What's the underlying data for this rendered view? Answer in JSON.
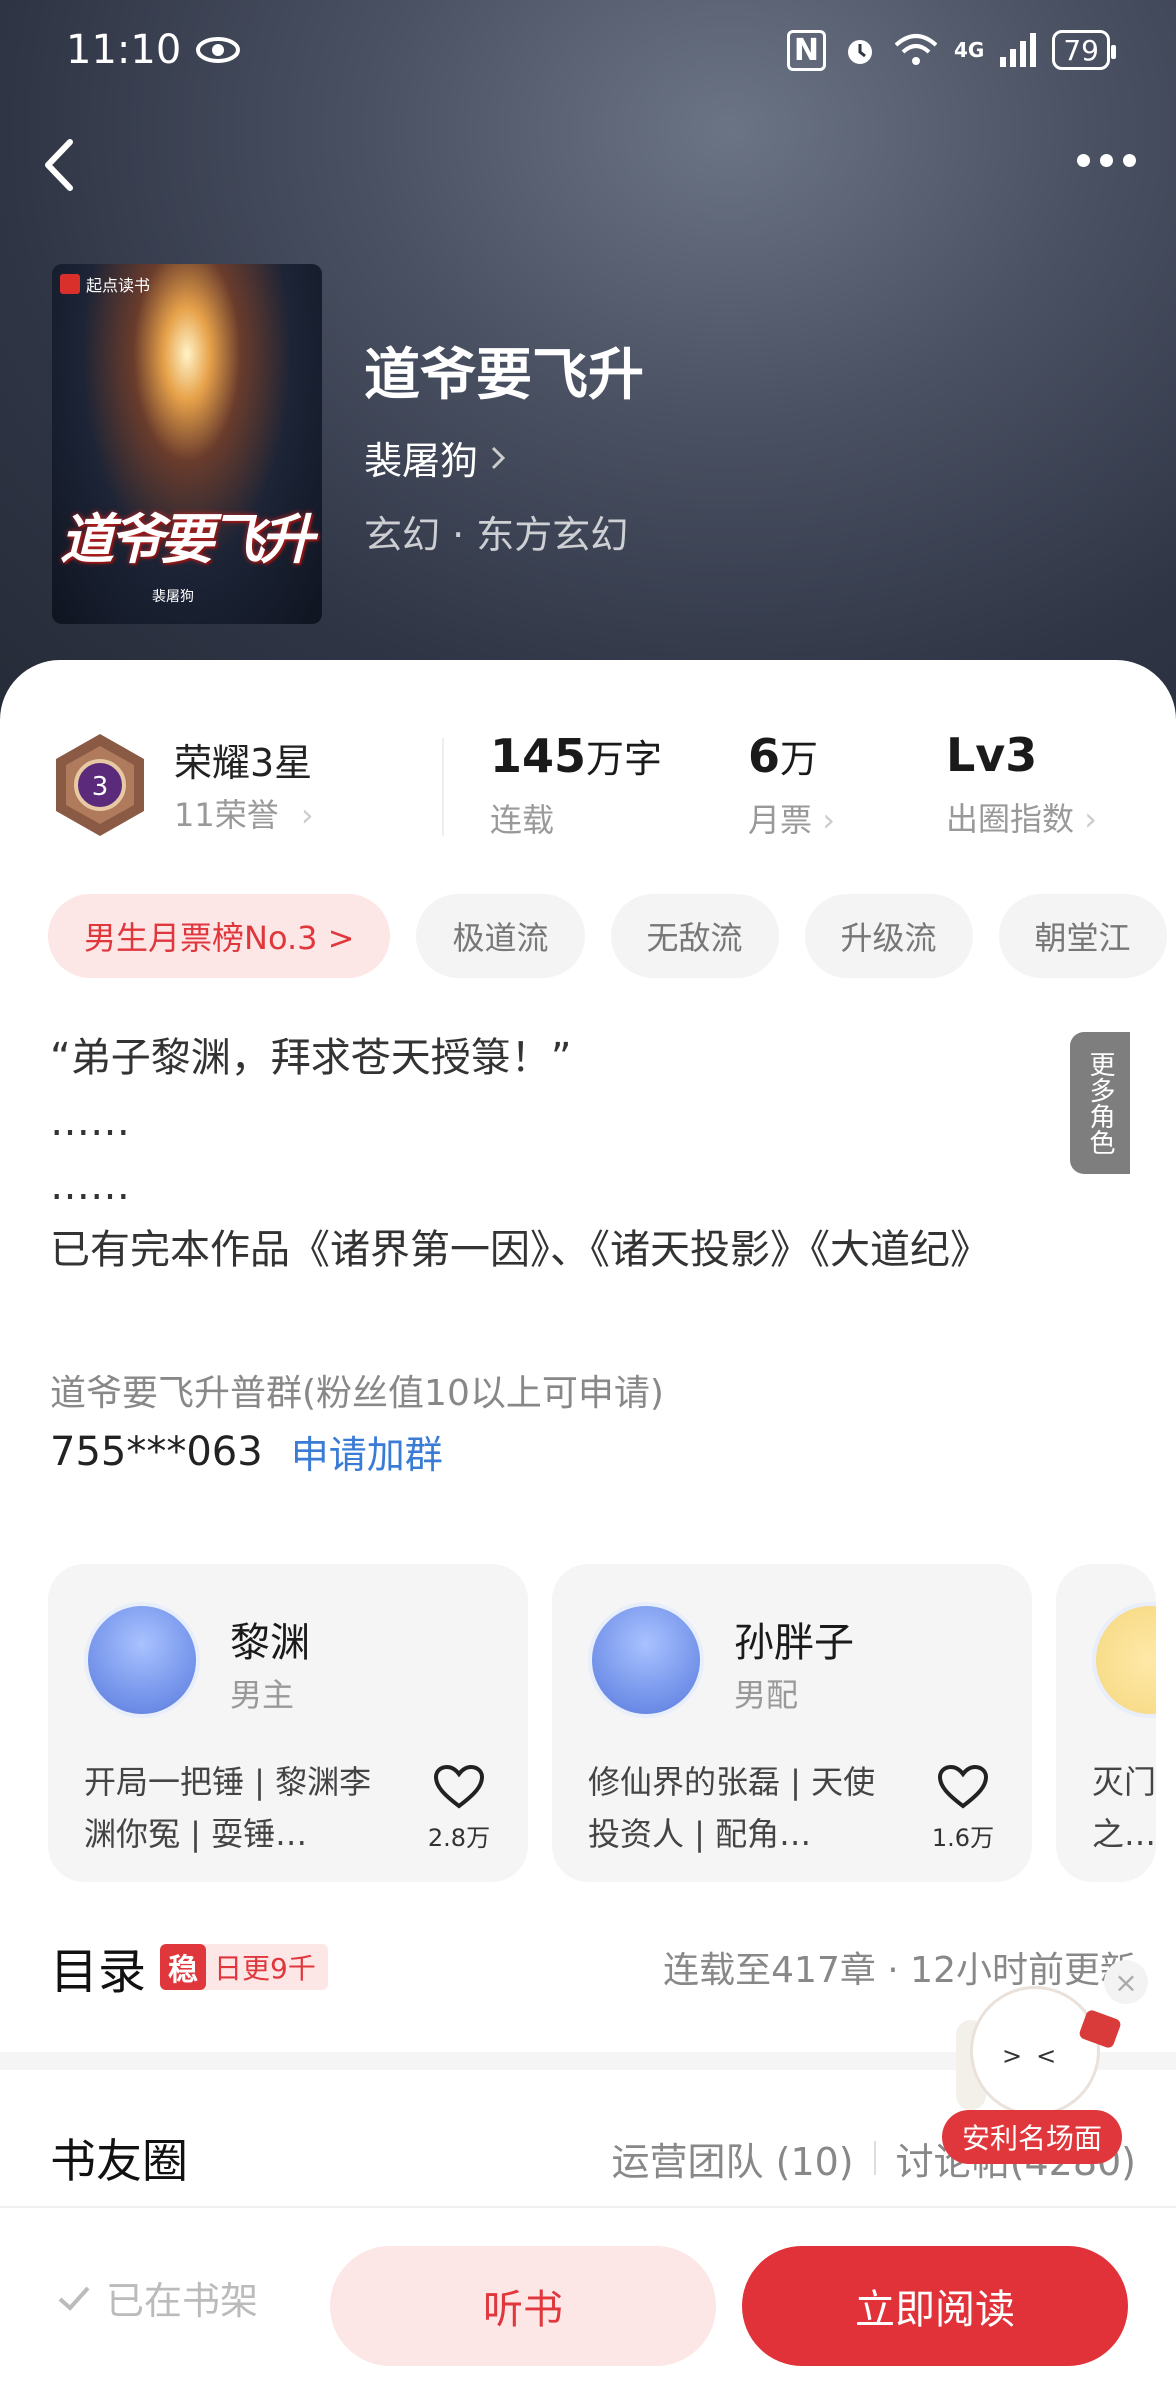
{
  "status_bar": {
    "time": "11:10",
    "battery": "79",
    "network": "4G"
  },
  "book": {
    "title": "道爷要飞升",
    "author": "裴屠狗",
    "genre": "玄幻 · 东方玄幻",
    "cover": {
      "publisher": "起点读书",
      "title": "道爷要飞升",
      "author": "裴屠狗"
    }
  },
  "stats": {
    "honor_title": "荣耀3星",
    "honor_sub": "11荣誉",
    "medal_level": "3",
    "words_num": "145",
    "words_unit": "万字",
    "words_label": "连载",
    "monthly_num": "6",
    "monthly_unit": "万",
    "monthly_label": "月票",
    "index_num": "Lv3",
    "index_label": "出圈指数"
  },
  "tags": [
    "男生月票榜No.3 >",
    "极道流",
    "无敌流",
    "升级流",
    "朝堂江"
  ],
  "intro": {
    "line1": "“弟子黎渊，拜求苍天授箓！”",
    "line2": "……",
    "line3": "……",
    "line4": "已有完本作品《诸界第一因》、《诸天投影》《大道纪》"
  },
  "fan_group": {
    "name": "道爷要飞升普群(粉丝值10以上可申请)",
    "number": "755***063",
    "apply_label": "申请加群"
  },
  "roles": [
    {
      "name": "黎渊",
      "type": "男主",
      "desc": "开局一把锤 | 黎渊李渊你冤 | 耍锤…",
      "likes": "2.8万"
    },
    {
      "name": "孙胖子",
      "type": "男配",
      "desc": "修仙界的张磊 | 天使投资人 | 配角…",
      "likes": "1.6万"
    },
    {
      "name": "",
      "type": "",
      "desc": "灭门之…一大哥",
      "likes": ""
    }
  ],
  "more_roles_label": "更多角色",
  "toc": {
    "title": "目录",
    "badge_char": "稳",
    "badge_text": "日更9千",
    "update": "连载至417章 · 12小时前更新"
  },
  "circle": {
    "title": "书友圈",
    "ops_team": "运营团队 (10)",
    "posts": "讨论帖(4280)"
  },
  "mascot": {
    "label": "安利名场面"
  },
  "bottom": {
    "shelf": "已在书架",
    "listen": "听书",
    "read": "立即阅读"
  },
  "colors": {
    "accent": "#e1323a",
    "accent_light": "#fde6e6",
    "link": "#3a7bd5"
  }
}
